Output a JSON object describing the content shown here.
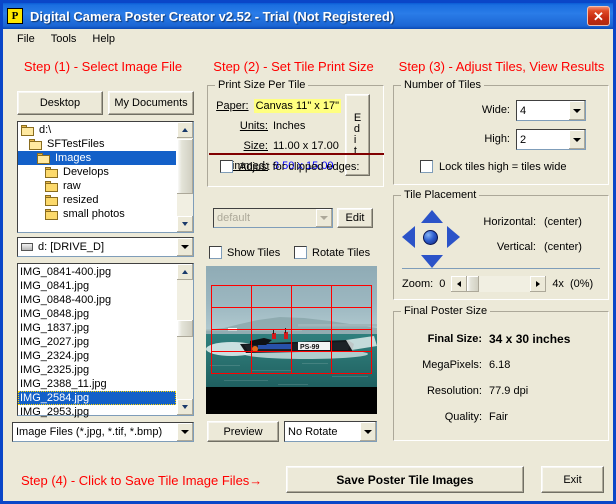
{
  "window": {
    "title": "Digital Camera Poster Creator v2.52 - Trial (Not Registered)",
    "app_icon": "poster-icon",
    "icon_letter": "P",
    "close_label": "✕",
    "accent_titlebar": "#2a7ce8",
    "accent_step": "#ff0000",
    "face_color": "#ece9d8"
  },
  "menu": {
    "items": [
      {
        "label": "File"
      },
      {
        "label": "Tools"
      },
      {
        "label": "Help"
      }
    ]
  },
  "step1": {
    "title": "Step (1) - Select Image File",
    "buttons": {
      "desktop": "Desktop",
      "my_documents": "My Documents"
    },
    "folder_tree": [
      {
        "label": "d:\\",
        "indent": 0,
        "selected": false,
        "open": true
      },
      {
        "label": "SFTestFiles",
        "indent": 1,
        "selected": false,
        "open": true
      },
      {
        "label": "Images",
        "indent": 2,
        "selected": true,
        "open": true
      },
      {
        "label": "Develops",
        "indent": 3,
        "selected": false,
        "open": false
      },
      {
        "label": "raw",
        "indent": 3,
        "selected": false,
        "open": false
      },
      {
        "label": "resized",
        "indent": 3,
        "selected": false,
        "open": false
      },
      {
        "label": "small photos",
        "indent": 3,
        "selected": false,
        "open": false
      }
    ],
    "drive_combo": {
      "value": "d: [DRIVE_D]",
      "icon": "drive-icon"
    },
    "file_list": [
      {
        "name": "IMG_0841-400.jpg",
        "selected": false
      },
      {
        "name": "IMG_0841.jpg",
        "selected": false
      },
      {
        "name": "IMG_0848-400.jpg",
        "selected": false
      },
      {
        "name": "IMG_0848.jpg",
        "selected": false
      },
      {
        "name": "IMG_1837.jpg",
        "selected": false
      },
      {
        "name": "IMG_2027.jpg",
        "selected": false
      },
      {
        "name": "IMG_2324.jpg",
        "selected": false
      },
      {
        "name": "IMG_2325.jpg",
        "selected": false
      },
      {
        "name": "IMG_2388_11.jpg",
        "selected": false
      },
      {
        "name": "IMG_2584.jpg",
        "selected": true
      },
      {
        "name": "IMG_2953.jpg",
        "selected": false
      }
    ],
    "filter_combo": {
      "value": "Image Files (*.jpg, *.tif, *.bmp)"
    }
  },
  "step2": {
    "title": "Step (2) - Set Tile Print Size",
    "print_size_group": "Print Size Per Tile",
    "rows": [
      {
        "label": "Paper:",
        "value": "Canvas 11\" x 17\"",
        "highlight": "#ffff80",
        "color": "#000000"
      },
      {
        "label": "Units:",
        "value": "Inches",
        "highlight": "",
        "color": "#000000"
      },
      {
        "label": "Size:",
        "value": "11.00 x 17.00",
        "highlight": "",
        "color": "#000000"
      },
      {
        "label": "Trimmed:",
        "value": "8.50 x 15.00",
        "highlight": "",
        "color": "#0000ff"
      }
    ],
    "edit_vertical_label": "Edit",
    "adjust_checkbox": {
      "label": "Adjust for clipped edges:",
      "checked": false
    },
    "adjust_combo": {
      "value": "default",
      "disabled": true
    },
    "adjust_edit_label": "Edit",
    "show_tiles": {
      "label": "Show Tiles",
      "checked": false
    },
    "rotate_tiles": {
      "label": "Rotate Tiles",
      "checked": false
    },
    "preview_button": "Preview",
    "rotate_combo": {
      "value": "No Rotate"
    },
    "preview_image": {
      "alt": "racing-powerboat-on-water",
      "tiles_wide": 4,
      "tiles_high": 4,
      "grid_color": "#ff0000"
    }
  },
  "step3": {
    "title": "Step (3) - Adjust Tiles, View Results",
    "number_of_tiles_group": "Number of Tiles",
    "wide": {
      "label": "Wide:",
      "value": "4"
    },
    "high": {
      "label": "High:",
      "value": "2"
    },
    "lock_checkbox": {
      "label": "Lock tiles high = tiles wide",
      "checked": false
    },
    "tile_placement_group": "Tile Placement",
    "dpad": "direction-pad",
    "horizontal": {
      "label": "Horizontal:",
      "value": "(center)"
    },
    "vertical": {
      "label": "Vertical:",
      "value": "(center)"
    },
    "zoom": {
      "label": "Zoom:",
      "min_label": "0",
      "max_label": "4x",
      "percent_label": "(0%)",
      "value": 0
    },
    "final_group": "Final Poster Size",
    "final_rows": [
      {
        "label": "Final Size:",
        "value": "34 x 30 inches",
        "bold": true
      },
      {
        "label": "MegaPixels:",
        "value": "6.18",
        "bold": false
      },
      {
        "label": "Resolution:",
        "value": "77.9 dpi",
        "bold": false
      },
      {
        "label": "Quality:",
        "value": "Fair",
        "bold": false
      }
    ]
  },
  "step4": {
    "title": "Step (4) - Click to Save Tile Image Files→",
    "save_button": "Save Poster Tile Images",
    "exit_button": "Exit"
  }
}
